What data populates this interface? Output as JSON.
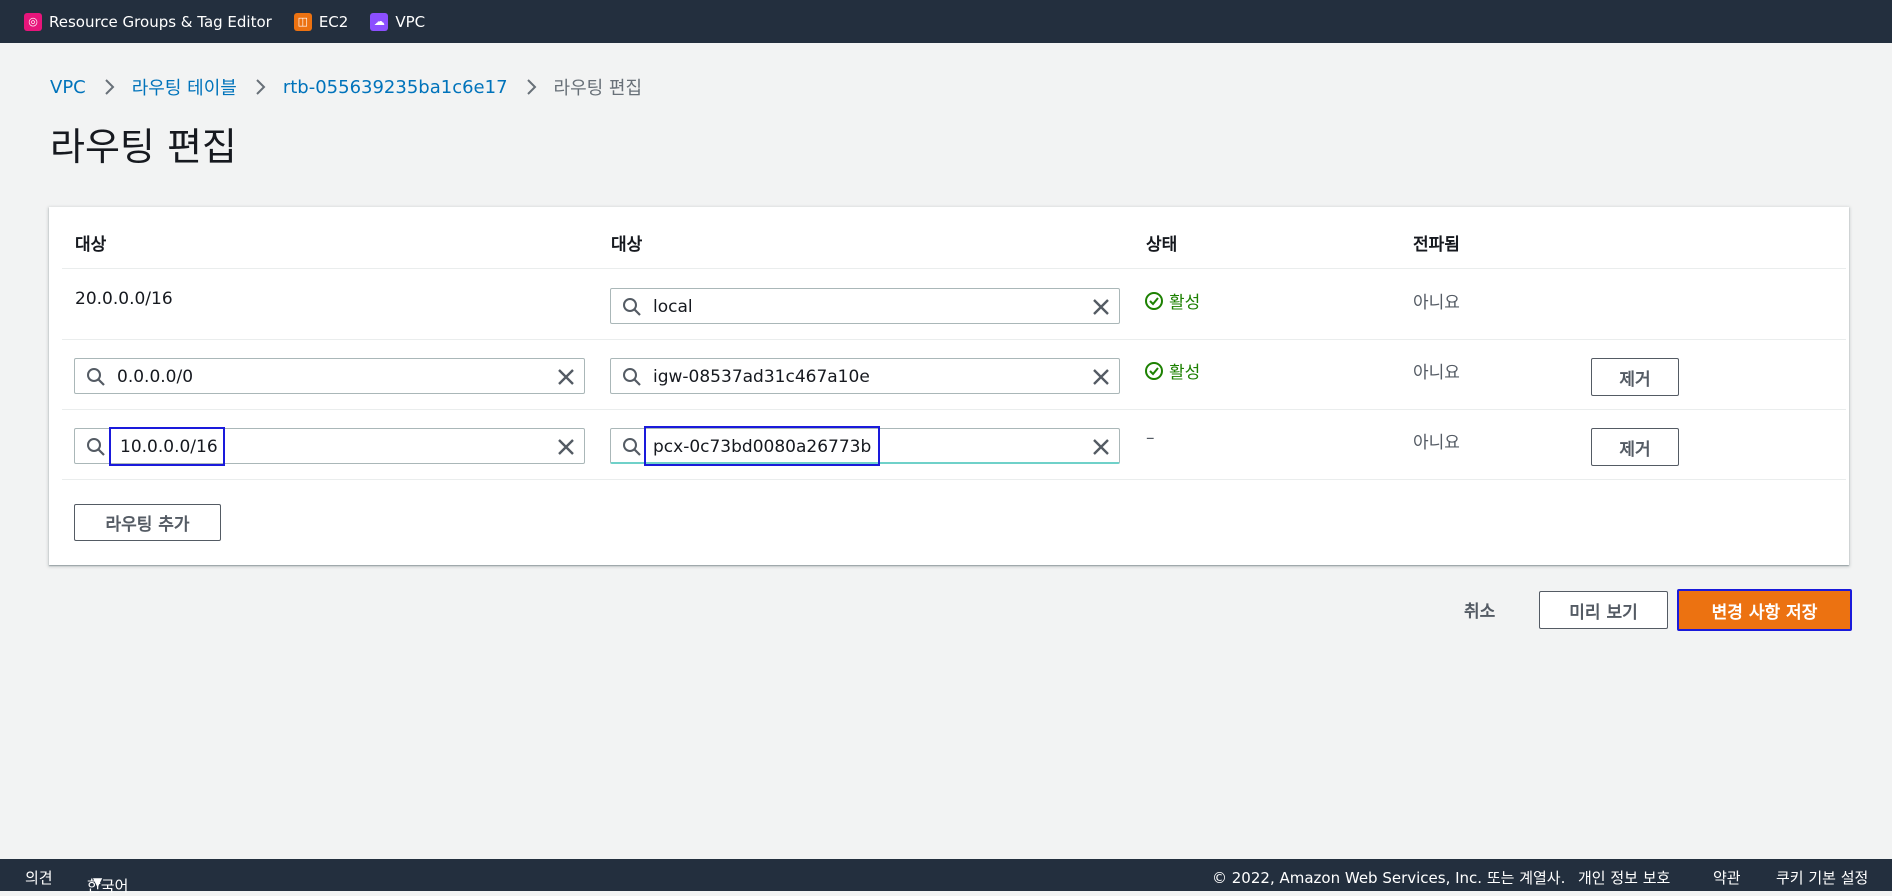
{
  "topbar": {
    "services": [
      {
        "label": "Resource Groups & Tag Editor",
        "color": "#e7157b"
      },
      {
        "label": "EC2",
        "color": "#ec7211"
      },
      {
        "label": "VPC",
        "color": "#8c4fff"
      }
    ]
  },
  "breadcrumb": {
    "items": [
      "VPC",
      "라우팅 테이블",
      "rtb-055639235ba1c6e17"
    ],
    "current": "라우팅 편집"
  },
  "page_title": "라우팅 편집",
  "table": {
    "headers": [
      "대상",
      "대상",
      "상태",
      "전파됨"
    ],
    "rows": [
      {
        "destination": "20.0.0.0/16",
        "target": "local",
        "status": "활성",
        "propagated": "아니요"
      },
      {
        "destination": "0.0.0.0/0",
        "target": "igw-08537ad31c467a10e",
        "status": "활성",
        "propagated": "아니요",
        "remove_label": "제거"
      },
      {
        "destination": "10.0.0.0/16",
        "target": "pcx-0c73bd0080a26773b",
        "status": "–",
        "propagated": "아니요",
        "remove_label": "제거"
      }
    ],
    "add_route_label": "라우팅 추가"
  },
  "actions": {
    "cancel": "취소",
    "preview": "미리 보기",
    "save": "변경 사항 저장"
  },
  "footer": {
    "feedback": "의견",
    "language": "한국어",
    "copyright": "© 2022, Amazon Web Services, Inc. 또는 계열사.",
    "privacy": "개인 정보 보호",
    "terms": "약관",
    "cookies": "쿠키 기본 설정"
  },
  "colors": {
    "accent": "#ec7211",
    "link": "#0073bb",
    "success": "#1d8102",
    "focus": "#1a1adb"
  }
}
